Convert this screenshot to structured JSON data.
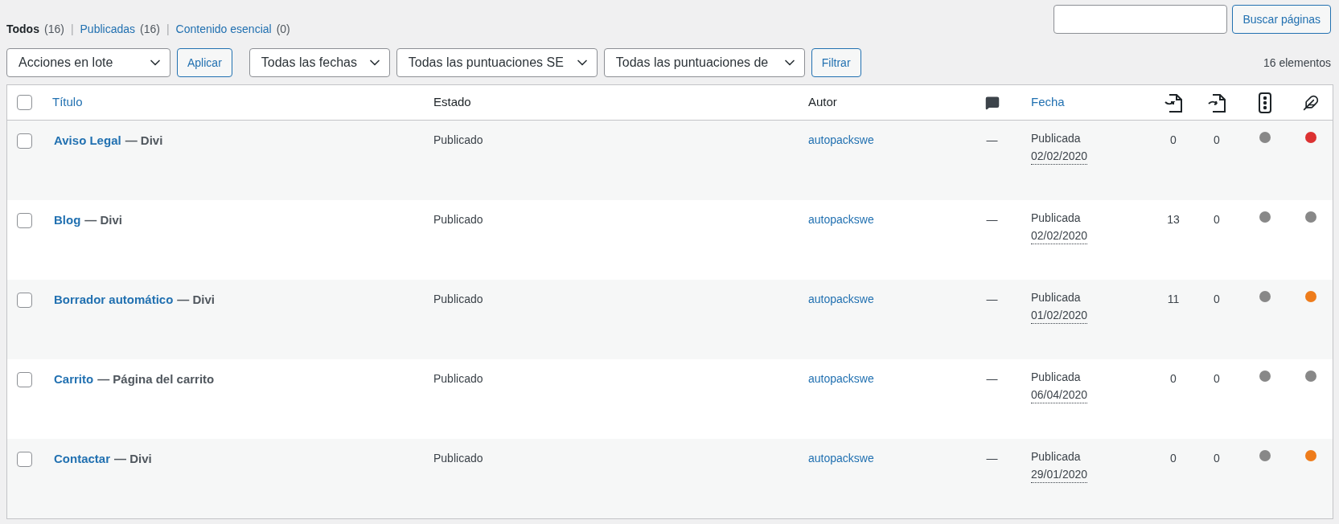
{
  "views": [
    {
      "label": "Todos",
      "count": "(16)",
      "selected": true
    },
    {
      "separator": "|",
      "label": "Publicadas",
      "count": "(16)",
      "selected": false
    },
    {
      "separator": "|",
      "label": "Contenido esencial",
      "count": "(0)",
      "selected": false
    }
  ],
  "search": {
    "button": "Buscar páginas"
  },
  "toolbar": {
    "bulk_actions": "Acciones en lote",
    "apply": "Aplicar",
    "dates": "Todas las fechas",
    "seo_scores": "Todas las puntuaciones SE",
    "readability_scores": "Todas las puntuaciones de",
    "filter": "Filtrar",
    "count": "16 elementos"
  },
  "table": {
    "select_all_checked": false,
    "columns": {
      "title": "Título",
      "status": "Estado",
      "author": "Autor",
      "date": "Fecha"
    },
    "rows": [
      {
        "checked": false,
        "title": "Aviso Legal",
        "page_state": "— Divi",
        "status": "Publicado",
        "author": "autopackswe",
        "comments": "—",
        "date_label": "Publicada",
        "date": "02/02/2020",
        "links_in": "0",
        "links_out": "0",
        "scores": [
          {
            "color": "#888888"
          },
          {
            "color": "#dc3232"
          }
        ]
      },
      {
        "checked": false,
        "title": "Blog",
        "page_state": "— Divi",
        "status": "Publicado",
        "author": "autopackswe",
        "comments": "—",
        "date_label": "Publicada",
        "date": "02/02/2020",
        "links_in": "13",
        "links_out": "0",
        "scores": [
          {
            "color": "#888888"
          },
          {
            "color": "#888888"
          }
        ]
      },
      {
        "checked": false,
        "title": "Borrador automático",
        "page_state": "— Divi",
        "status": "Publicado",
        "author": "autopackswe",
        "comments": "—",
        "date_label": "Publicada",
        "date": "01/02/2020",
        "links_in": "11",
        "links_out": "0",
        "scores": [
          {
            "color": "#888888"
          },
          {
            "color": "#ee7c1b"
          }
        ]
      },
      {
        "checked": false,
        "title": "Carrito",
        "page_state": "— Página del carrito",
        "status": "Publicado",
        "author": "autopackswe",
        "comments": "—",
        "date_label": "Publicada",
        "date": "06/04/2020",
        "links_in": "0",
        "links_out": "0",
        "scores": [
          {
            "color": "#888888"
          },
          {
            "color": "#888888"
          }
        ]
      },
      {
        "checked": false,
        "title": "Contactar",
        "page_state": "— Divi",
        "status": "Publicado",
        "author": "autopackswe",
        "comments": "—",
        "date_label": "Publicada",
        "date": "29/01/2020",
        "links_in": "0",
        "links_out": "0",
        "scores": [
          {
            "color": "#888888"
          },
          {
            "color": "#ee7c1b"
          }
        ]
      }
    ]
  }
}
